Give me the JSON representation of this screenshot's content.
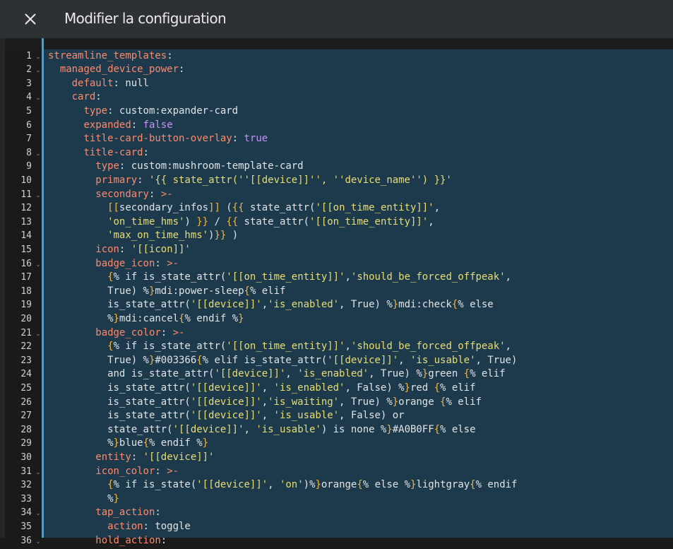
{
  "dialog": {
    "title": "Modifier la configuration",
    "close_icon": "close-icon"
  },
  "editor": {
    "language": "yaml",
    "fold_icon": "chevron-down-icon",
    "colors": {
      "key": "#ff8a6b",
      "plain": "#e1e4e6",
      "string": "#e8dd74",
      "brace": "#f2b544",
      "bool": "#c593f5",
      "editor_bg": "#1d3a4c",
      "accent": "#2ea8e0"
    },
    "lines": [
      {
        "n": "1",
        "fold": true,
        "tokens": [
          [
            "k",
            "streamline_templates"
          ],
          [
            "p",
            ":"
          ]
        ]
      },
      {
        "n": "2",
        "fold": true,
        "tokens": [
          [
            "p",
            "  "
          ],
          [
            "k",
            "managed_device_power"
          ],
          [
            "p",
            ":"
          ]
        ]
      },
      {
        "n": "3",
        "fold": false,
        "tokens": [
          [
            "p",
            "    "
          ],
          [
            "k",
            "default"
          ],
          [
            "p",
            ": null"
          ]
        ]
      },
      {
        "n": "4",
        "fold": true,
        "tokens": [
          [
            "p",
            "    "
          ],
          [
            "k",
            "card"
          ],
          [
            "p",
            ":"
          ]
        ]
      },
      {
        "n": "5",
        "fold": false,
        "tokens": [
          [
            "p",
            "      "
          ],
          [
            "k",
            "type"
          ],
          [
            "p",
            ": custom:expander-card"
          ]
        ]
      },
      {
        "n": "6",
        "fold": false,
        "tokens": [
          [
            "p",
            "      "
          ],
          [
            "k",
            "expanded"
          ],
          [
            "p",
            ": "
          ],
          [
            "b",
            "false"
          ]
        ]
      },
      {
        "n": "7",
        "fold": false,
        "tokens": [
          [
            "p",
            "      "
          ],
          [
            "k",
            "title-card-button-overlay"
          ],
          [
            "p",
            ": "
          ],
          [
            "b",
            "true"
          ]
        ]
      },
      {
        "n": "8",
        "fold": true,
        "tokens": [
          [
            "p",
            "      "
          ],
          [
            "k",
            "title-card"
          ],
          [
            "p",
            ":"
          ]
        ]
      },
      {
        "n": "9",
        "fold": false,
        "tokens": [
          [
            "p",
            "        "
          ],
          [
            "k",
            "type"
          ],
          [
            "p",
            ": custom:mushroom-template-card"
          ]
        ]
      },
      {
        "n": "10",
        "fold": false,
        "tokens": [
          [
            "p",
            "        "
          ],
          [
            "k",
            "primary"
          ],
          [
            "p",
            ": "
          ],
          [
            "s",
            "'{{ state_attr(''[[device]]'', ''device_name'') }}'"
          ]
        ]
      },
      {
        "n": "11",
        "fold": true,
        "tokens": [
          [
            "p",
            "        "
          ],
          [
            "k",
            "secondary"
          ],
          [
            "p",
            ": "
          ],
          [
            "k",
            ">-"
          ]
        ]
      },
      {
        "n": "12",
        "fold": false,
        "tokens": [
          [
            "p",
            "          "
          ],
          [
            "r",
            "[["
          ],
          [
            "p",
            "secondary_infos"
          ],
          [
            "r",
            "]]"
          ],
          [
            "p",
            " ("
          ],
          [
            "r",
            "{{"
          ],
          [
            "p",
            " state_attr("
          ],
          [
            "s",
            "'[[on_time_entity]]'"
          ],
          [
            "p",
            ","
          ]
        ]
      },
      {
        "n": "13",
        "fold": false,
        "tokens": [
          [
            "p",
            "          "
          ],
          [
            "s",
            "'on_time_hms'"
          ],
          [
            "p",
            ") "
          ],
          [
            "r",
            "}}"
          ],
          [
            "p",
            " / "
          ],
          [
            "r",
            "{{"
          ],
          [
            "p",
            " state_attr("
          ],
          [
            "s",
            "'[[on_time_entity]]'"
          ],
          [
            "p",
            ","
          ]
        ]
      },
      {
        "n": "14",
        "fold": false,
        "tokens": [
          [
            "p",
            "          "
          ],
          [
            "s",
            "'max_on_time_hms'"
          ],
          [
            "p",
            ")"
          ],
          [
            "r",
            "}}"
          ],
          [
            "p",
            " )"
          ]
        ]
      },
      {
        "n": "15",
        "fold": false,
        "tokens": [
          [
            "p",
            "        "
          ],
          [
            "k",
            "icon"
          ],
          [
            "p",
            ": "
          ],
          [
            "s",
            "'[[icon]]'"
          ]
        ]
      },
      {
        "n": "16",
        "fold": true,
        "tokens": [
          [
            "p",
            "        "
          ],
          [
            "k",
            "badge_icon"
          ],
          [
            "p",
            ": "
          ],
          [
            "k",
            ">-"
          ]
        ]
      },
      {
        "n": "17",
        "fold": false,
        "tokens": [
          [
            "p",
            "          "
          ],
          [
            "r",
            "{"
          ],
          [
            "p",
            "% if is_state_attr("
          ],
          [
            "s",
            "'[[on_time_entity]]'"
          ],
          [
            "p",
            ","
          ],
          [
            "s",
            "'should_be_forced_offpeak'"
          ],
          [
            "p",
            ","
          ]
        ]
      },
      {
        "n": "18",
        "fold": false,
        "tokens": [
          [
            "p",
            "          True) %"
          ],
          [
            "r",
            "}"
          ],
          [
            "p",
            "mdi:power-sleep"
          ],
          [
            "r",
            "{"
          ],
          [
            "p",
            "% elif"
          ]
        ]
      },
      {
        "n": "19",
        "fold": false,
        "tokens": [
          [
            "p",
            "          is_state_attr("
          ],
          [
            "s",
            "'[[device]]'"
          ],
          [
            "p",
            ","
          ],
          [
            "s",
            "'is_enabled'"
          ],
          [
            "p",
            ", True) %"
          ],
          [
            "r",
            "}"
          ],
          [
            "p",
            "mdi:check"
          ],
          [
            "r",
            "{"
          ],
          [
            "p",
            "% else"
          ]
        ]
      },
      {
        "n": "20",
        "fold": false,
        "tokens": [
          [
            "p",
            "          %"
          ],
          [
            "r",
            "}"
          ],
          [
            "p",
            "mdi:cancel"
          ],
          [
            "r",
            "{"
          ],
          [
            "p",
            "% endif %"
          ],
          [
            "r",
            "}"
          ]
        ]
      },
      {
        "n": "21",
        "fold": true,
        "tokens": [
          [
            "p",
            "        "
          ],
          [
            "k",
            "badge_color"
          ],
          [
            "p",
            ": "
          ],
          [
            "k",
            ">-"
          ]
        ]
      },
      {
        "n": "22",
        "fold": false,
        "tokens": [
          [
            "p",
            "          "
          ],
          [
            "r",
            "{"
          ],
          [
            "p",
            "% if is_state_attr("
          ],
          [
            "s",
            "'[[on_time_entity]]'"
          ],
          [
            "p",
            ","
          ],
          [
            "s",
            "'should_be_forced_offpeak'"
          ],
          [
            "p",
            ","
          ]
        ]
      },
      {
        "n": "23",
        "fold": false,
        "tokens": [
          [
            "p",
            "          True) %"
          ],
          [
            "r",
            "}"
          ],
          [
            "p",
            "#003366"
          ],
          [
            "r",
            "{"
          ],
          [
            "p",
            "% elif is_state_attr("
          ],
          [
            "s",
            "'[[device]]'"
          ],
          [
            "p",
            ", "
          ],
          [
            "s",
            "'is_usable'"
          ],
          [
            "p",
            ", True)"
          ]
        ]
      },
      {
        "n": "24",
        "fold": false,
        "tokens": [
          [
            "p",
            "          and is_state_attr("
          ],
          [
            "s",
            "'[[device]]'"
          ],
          [
            "p",
            ", "
          ],
          [
            "s",
            "'is_enabled'"
          ],
          [
            "p",
            ", True) %"
          ],
          [
            "r",
            "}"
          ],
          [
            "p",
            "green "
          ],
          [
            "r",
            "{"
          ],
          [
            "p",
            "% elif"
          ]
        ]
      },
      {
        "n": "25",
        "fold": false,
        "tokens": [
          [
            "p",
            "          is_state_attr("
          ],
          [
            "s",
            "'[[device]]'"
          ],
          [
            "p",
            ", "
          ],
          [
            "s",
            "'is_enabled'"
          ],
          [
            "p",
            ", False) %"
          ],
          [
            "r",
            "}"
          ],
          [
            "p",
            "red "
          ],
          [
            "r",
            "{"
          ],
          [
            "p",
            "% elif"
          ]
        ]
      },
      {
        "n": "26",
        "fold": false,
        "tokens": [
          [
            "p",
            "          is_state_attr("
          ],
          [
            "s",
            "'[[device]]'"
          ],
          [
            "p",
            ","
          ],
          [
            "s",
            "'is_waiting'"
          ],
          [
            "p",
            ", True) %"
          ],
          [
            "r",
            "}"
          ],
          [
            "p",
            "orange "
          ],
          [
            "r",
            "{"
          ],
          [
            "p",
            "% elif"
          ]
        ]
      },
      {
        "n": "27",
        "fold": false,
        "tokens": [
          [
            "p",
            "          is_state_attr("
          ],
          [
            "s",
            "'[[device]]'"
          ],
          [
            "p",
            ", "
          ],
          [
            "s",
            "'is_usable'"
          ],
          [
            "p",
            ", False) or"
          ]
        ]
      },
      {
        "n": "28",
        "fold": false,
        "tokens": [
          [
            "p",
            "          state_attr("
          ],
          [
            "s",
            "'[[device]]'"
          ],
          [
            "p",
            ", "
          ],
          [
            "s",
            "'is_usable'"
          ],
          [
            "p",
            ") is none %"
          ],
          [
            "r",
            "}"
          ],
          [
            "p",
            "#A0B0FF"
          ],
          [
            "r",
            "{"
          ],
          [
            "p",
            "% else"
          ]
        ]
      },
      {
        "n": "29",
        "fold": false,
        "tokens": [
          [
            "p",
            "          %"
          ],
          [
            "r",
            "}"
          ],
          [
            "p",
            "blue"
          ],
          [
            "r",
            "{"
          ],
          [
            "p",
            "% endif %"
          ],
          [
            "r",
            "}"
          ]
        ]
      },
      {
        "n": "30",
        "fold": false,
        "tokens": [
          [
            "p",
            "        "
          ],
          [
            "k",
            "entity"
          ],
          [
            "p",
            ": "
          ],
          [
            "s",
            "'[[device]]'"
          ]
        ]
      },
      {
        "n": "31",
        "fold": true,
        "tokens": [
          [
            "p",
            "        "
          ],
          [
            "k",
            "icon_color"
          ],
          [
            "p",
            ": "
          ],
          [
            "k",
            ">-"
          ]
        ]
      },
      {
        "n": "32",
        "fold": false,
        "tokens": [
          [
            "p",
            "          "
          ],
          [
            "r",
            "{"
          ],
          [
            "p",
            "% if is_state("
          ],
          [
            "s",
            "'[[device]]'"
          ],
          [
            "p",
            ", "
          ],
          [
            "s",
            "'on'"
          ],
          [
            "p",
            ")%"
          ],
          [
            "r",
            "}"
          ],
          [
            "p",
            "orange"
          ],
          [
            "r",
            "{"
          ],
          [
            "p",
            "% else %"
          ],
          [
            "r",
            "}"
          ],
          [
            "p",
            "lightgray"
          ],
          [
            "r",
            "{"
          ],
          [
            "p",
            "% endif"
          ]
        ]
      },
      {
        "n": "33",
        "fold": false,
        "tokens": [
          [
            "p",
            "          %"
          ],
          [
            "r",
            "}"
          ]
        ]
      },
      {
        "n": "34",
        "fold": true,
        "tokens": [
          [
            "p",
            "        "
          ],
          [
            "k",
            "tap_action"
          ],
          [
            "p",
            ":"
          ]
        ]
      },
      {
        "n": "35",
        "fold": false,
        "tokens": [
          [
            "p",
            "          "
          ],
          [
            "k",
            "action"
          ],
          [
            "p",
            ": toggle"
          ]
        ]
      },
      {
        "n": "36",
        "fold": true,
        "tokens": [
          [
            "p",
            "        "
          ],
          [
            "k",
            "hold_action"
          ],
          [
            "p",
            ":"
          ]
        ]
      }
    ]
  }
}
